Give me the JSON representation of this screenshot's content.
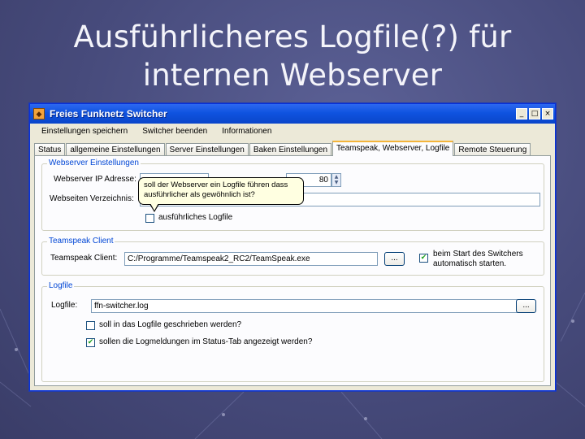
{
  "slide": {
    "title": "Ausführlicheres Logfile(?) für\ninternen Webserver"
  },
  "window": {
    "title": "Freies Funknetz Switcher",
    "controls": {
      "minimize": "_",
      "maximize": "□",
      "close": "×"
    }
  },
  "menu": {
    "items": [
      "Einstellungen speichern",
      "Switcher beenden",
      "Informationen"
    ]
  },
  "tabs": [
    {
      "label": "Status",
      "active": false
    },
    {
      "label": "allgemeine Einstellungen",
      "active": false
    },
    {
      "label": "Server Einstellungen",
      "active": false
    },
    {
      "label": "Baken Einstellungen",
      "active": false
    },
    {
      "label": "Teamspeak, Webserver, Logfile",
      "active": true
    },
    {
      "label": "Remote Steuerung",
      "active": false
    }
  ],
  "webserver": {
    "legend": "Webserver Einstellungen",
    "ip_label": "Webserver IP Adresse:",
    "ip_value": "",
    "port_value": "80",
    "dir_label": "Webseiten Verzeichnis:",
    "dir_value": "",
    "verbose_label": "ausführliches Logfile",
    "verbose_checked": false,
    "tooltip": "soll der Webserver ein Logfile führen dass ausführlicher als gewöhnlich ist?"
  },
  "teamspeak": {
    "legend": "Teamspeak Client",
    "client_label": "Teamspeak Client:",
    "client_value": "C:/Programme/Teamspeak2_RC2/TeamSpeak.exe",
    "browse": "...",
    "autostart_label": "beim Start des Switchers automatisch starten.",
    "autostart_checked": true
  },
  "logfile": {
    "legend": "Logfile",
    "file_label": "Logfile:",
    "file_value": "ffn-switcher.log",
    "browse": "...",
    "write_label": "soll in das Logfile geschrieben werden?",
    "write_checked": false,
    "status_label": "sollen die Logmeldungen im Status-Tab angezeigt werden?",
    "status_checked": true
  },
  "colors": {
    "titlebar": "#0a45c9",
    "legend": "#0046d5",
    "tab_highlight": "#f4b43a",
    "check": "#21a121",
    "tooltip_bg": "#ffffe1"
  }
}
